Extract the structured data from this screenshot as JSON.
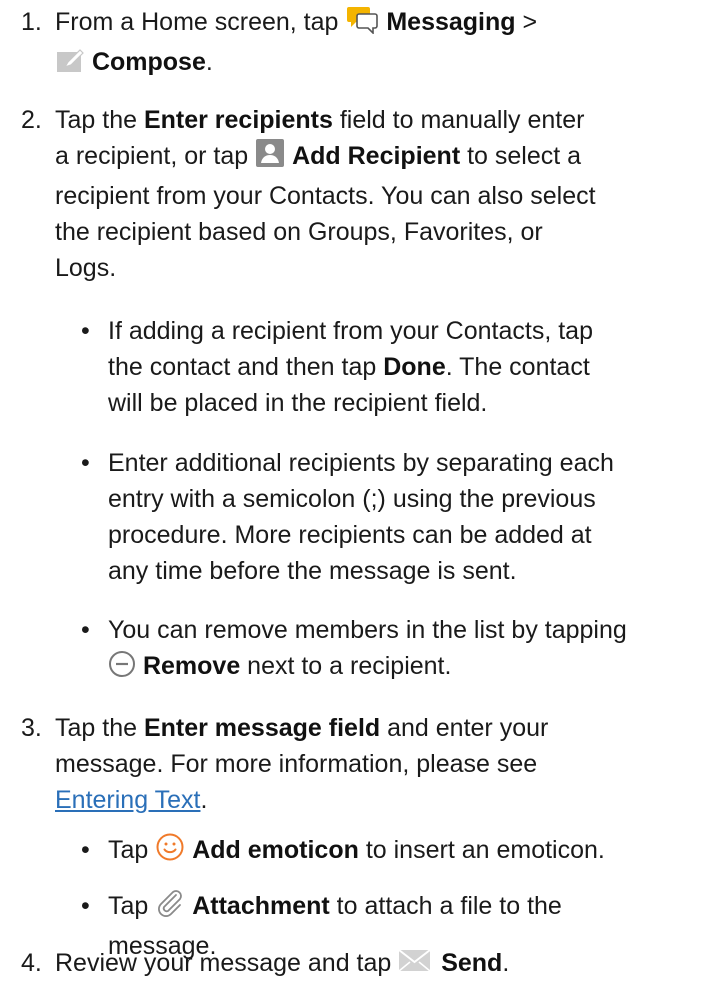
{
  "step1": {
    "num": "1.",
    "t1": "From a Home screen, tap ",
    "b1": "Messaging",
    "t2": " >",
    "b2": "Compose",
    "t3": "."
  },
  "step2": {
    "num": "2.",
    "t1": "Tap the ",
    "b1": "Enter recipients",
    "t2": " field to manually enter",
    "t3": "a recipient, or tap ",
    "b2": "Add Recipient",
    "t4": " to select a",
    "t5": "recipient from your Contacts. You can also select",
    "t6": "the recipient based on Groups, Favorites, or",
    "t7": "Logs."
  },
  "bullet_a": {
    "dot": "•",
    "t1": "If adding a recipient from your Contacts, tap",
    "t2": "the contact and then tap ",
    "b1": "Done",
    "t3": ". The contact",
    "t4": "will be placed in the recipient field."
  },
  "bullet_b": {
    "dot": "•",
    "t1": "Enter additional recipients by separating each",
    "t2": "entry with a semicolon (;) using the previous",
    "t3": "procedure. More recipients can be added at",
    "t4": "any time before the message is sent."
  },
  "bullet_c": {
    "dot": "•",
    "t1": "You can remove members in the list by tapping",
    "b1": "Remove",
    "t2": " next to a recipient."
  },
  "step3": {
    "num": "3.",
    "t1": "Tap the ",
    "b1": "Enter message field",
    "t2": " and enter your",
    "t3": "message. For more information, please see",
    "link": "Entering Text",
    "t4": "."
  },
  "bullet_d": {
    "dot": "•",
    "t1": "Tap ",
    "b1": "Add emoticon",
    "t2": " to insert an emoticon."
  },
  "bullet_e": {
    "dot": "•",
    "t1": "Tap ",
    "b1": "Attachment",
    "t2": " to attach a file to the",
    "t3": "message."
  },
  "step4": {
    "num": "4.",
    "t1": "Review your message and tap ",
    "b1": "Send",
    "t2": "."
  },
  "colors": {
    "link": "#2a6fb8",
    "messaging_icon": "#f4b400",
    "contact_icon": "#8a8a8a",
    "emoticon_icon": "#f07a2a"
  }
}
